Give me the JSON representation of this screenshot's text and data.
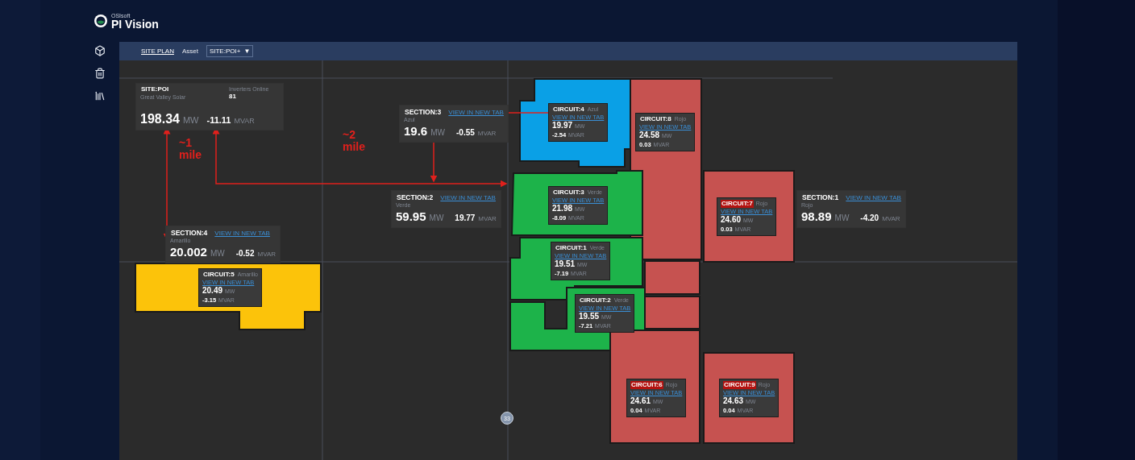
{
  "app": {
    "vendor": "OSIsoft",
    "title": "PI Vision"
  },
  "toolbar": {
    "breadcrumb": "SITE PLAN",
    "asset_label": "Asset",
    "asset_value": "SITE:POI+",
    "dropdown_glyph": "▼"
  },
  "site": {
    "name": "SITE:POI",
    "region": "Great Valley Solar",
    "inverters_label": "Inverters Online",
    "inverters": "81",
    "mw": "198.34",
    "mw_unit": "MW",
    "mvar": "-11.11",
    "mvar_unit": "MVAR"
  },
  "sections": [
    {
      "name": "SECTION:3",
      "link": "VIEW IN NEW TAB",
      "region": "Azul",
      "mw": "19.6",
      "mw_unit": "MW",
      "mvar": "-0.55",
      "mvar_unit": "MVAR"
    },
    {
      "name": "SECTION:2",
      "link": "VIEW IN NEW TAB",
      "region": "Verde",
      "mw": "59.95",
      "mw_unit": "MW",
      "mvar": "19.77",
      "mvar_unit": "MVAR"
    },
    {
      "name": "SECTION:1",
      "link": "VIEW IN NEW TAB",
      "region": "Rojo",
      "mw": "98.89",
      "mw_unit": "MW",
      "mvar": "-4.20",
      "mvar_unit": "MVAR"
    },
    {
      "name": "SECTION:4",
      "link": "VIEW IN NEW TAB",
      "region": "Amarillo",
      "mw": "20.002",
      "mw_unit": "MW",
      "mvar": "-0.52",
      "mvar_unit": "MVAR"
    }
  ],
  "circuits": [
    {
      "name": "CIRCUIT:4",
      "region": "Azul",
      "link": "VIEW IN NEW TAB",
      "mw": "19.97",
      "mw_unit": "MW",
      "mvar": "-2.54",
      "mvar_unit": "MVAR",
      "color": "#0aa0e6",
      "alarm": false
    },
    {
      "name": "CIRCUIT:8",
      "region": "Rojo",
      "link": "VIEW IN NEW TAB",
      "mw": "24.58",
      "mw_unit": "MW",
      "mvar": "0.03",
      "mvar_unit": "MVAR",
      "color": "#c65250",
      "alarm": false
    },
    {
      "name": "CIRCUIT:3",
      "region": "Verde",
      "link": "VIEW IN NEW TAB",
      "mw": "21.98",
      "mw_unit": "MW",
      "mvar": "-8.09",
      "mvar_unit": "MVAR",
      "color": "#1db34a",
      "alarm": false
    },
    {
      "name": "CIRCUIT:7",
      "region": "Rojo",
      "link": "VIEW IN NEW TAB",
      "mw": "24.60",
      "mw_unit": "MW",
      "mvar": "0.03",
      "mvar_unit": "MVAR",
      "color": "#c65250",
      "alarm": true
    },
    {
      "name": "CIRCUIT:1",
      "region": "Verde",
      "link": "VIEW IN NEW TAB",
      "mw": "19.51",
      "mw_unit": "MW",
      "mvar": "-7.19",
      "mvar_unit": "MVAR",
      "color": "#1db34a",
      "alarm": false
    },
    {
      "name": "CIRCUIT:5",
      "region": "Amarillo",
      "link": "VIEW IN NEW TAB",
      "mw": "20.49",
      "mw_unit": "MW",
      "mvar": "-3.15",
      "mvar_unit": "MVAR",
      "color": "#fcc30a",
      "alarm": false
    },
    {
      "name": "CIRCUIT:2",
      "region": "Verde",
      "link": "VIEW IN NEW TAB",
      "mw": "19.55",
      "mw_unit": "MW",
      "mvar": "-7.21",
      "mvar_unit": "MVAR",
      "color": "#1db34a",
      "alarm": false
    },
    {
      "name": "CIRCUIT:6",
      "region": "Rojo",
      "link": "VIEW IN NEW TAB",
      "mw": "24.61",
      "mw_unit": "MW",
      "mvar": "0.04",
      "mvar_unit": "MVAR",
      "color": "#c65250",
      "alarm": true
    },
    {
      "name": "CIRCUIT:9",
      "region": "Rojo",
      "link": "VIEW IN NEW TAB",
      "mw": "24.63",
      "mw_unit": "MW",
      "mvar": "0.04",
      "mvar_unit": "MVAR",
      "color": "#c65250",
      "alarm": true
    }
  ],
  "annotations": [
    {
      "label": "~1 mile"
    },
    {
      "label": "~2 mile"
    }
  ],
  "marker": "33"
}
